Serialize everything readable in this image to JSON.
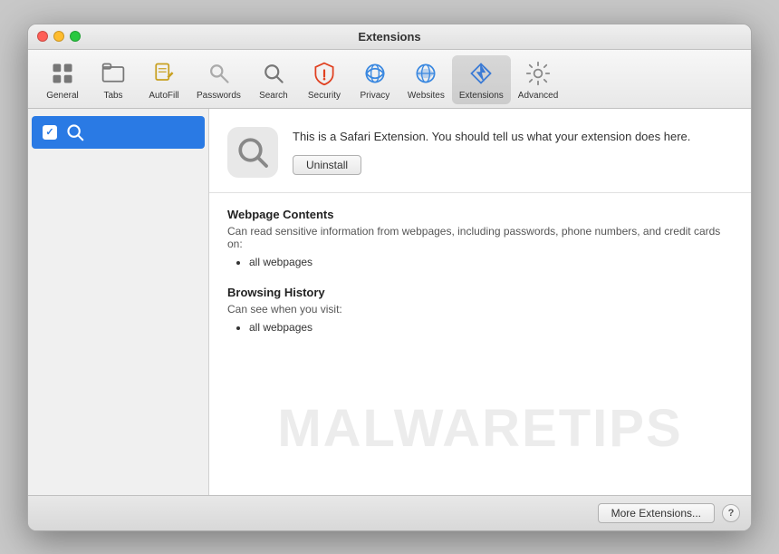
{
  "window": {
    "title": "Extensions"
  },
  "toolbar": {
    "items": [
      {
        "id": "general",
        "label": "General",
        "icon": "general"
      },
      {
        "id": "tabs",
        "label": "Tabs",
        "icon": "tabs"
      },
      {
        "id": "autofill",
        "label": "AutoFill",
        "icon": "autofill"
      },
      {
        "id": "passwords",
        "label": "Passwords",
        "icon": "passwords"
      },
      {
        "id": "search",
        "label": "Search",
        "icon": "search"
      },
      {
        "id": "security",
        "label": "Security",
        "icon": "security"
      },
      {
        "id": "privacy",
        "label": "Privacy",
        "icon": "privacy"
      },
      {
        "id": "websites",
        "label": "Websites",
        "icon": "websites"
      },
      {
        "id": "extensions",
        "label": "Extensions",
        "icon": "extensions",
        "active": true
      },
      {
        "id": "advanced",
        "label": "Advanced",
        "icon": "advanced"
      }
    ]
  },
  "sidebar": {
    "items": [
      {
        "id": "search-ext",
        "label": "",
        "enabled": true,
        "selected": true
      }
    ]
  },
  "extension": {
    "description": "This is a Safari Extension. You should tell us what your extension does here.",
    "uninstall_label": "Uninstall",
    "permissions": [
      {
        "title": "Webpage Contents",
        "description": "Can read sensitive information from webpages, including passwords, phone numbers, and credit cards on:",
        "items": [
          "all webpages"
        ]
      },
      {
        "title": "Browsing History",
        "description": "Can see when you visit:",
        "items": [
          "all webpages"
        ]
      }
    ]
  },
  "bottombar": {
    "more_extensions_label": "More Extensions...",
    "help_label": "?"
  },
  "watermark": {
    "text": "MALWARETIPS"
  }
}
